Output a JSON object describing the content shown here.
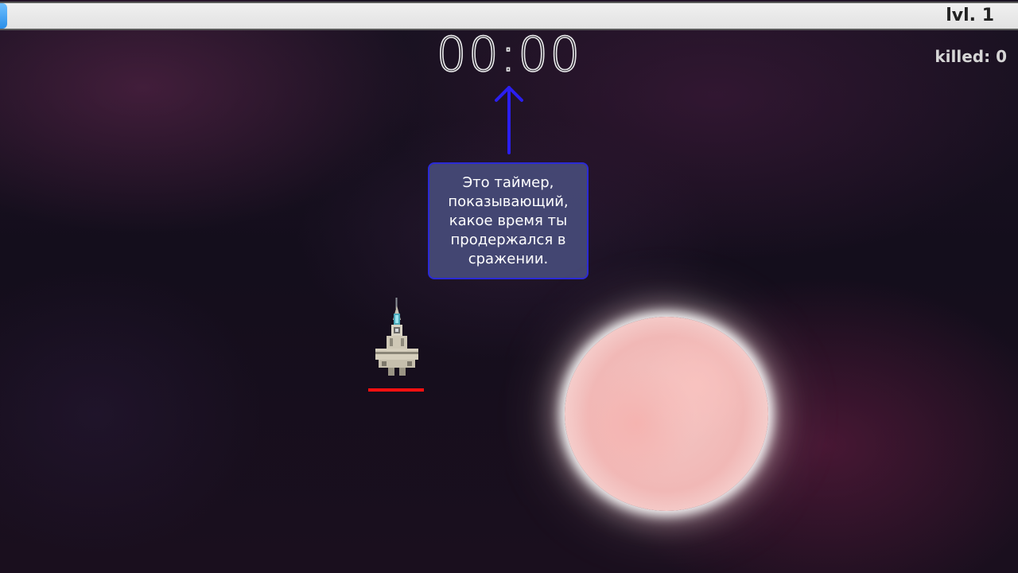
{
  "hud": {
    "level_label": "lvl. 1",
    "xp_progress": 0.007,
    "timer": "00:00",
    "killed_label": "killed: 0"
  },
  "tutorial": {
    "tooltip_text": "Это таймер, показывающий, какое время ты продержался в сражении.",
    "arrow_color": "#2b1ef0"
  },
  "player": {
    "sprite": "spaceship",
    "health_fraction": 1.0,
    "health_color": "#ff1010"
  },
  "scene": {
    "object": "sun",
    "background_color": "#140e1c"
  }
}
